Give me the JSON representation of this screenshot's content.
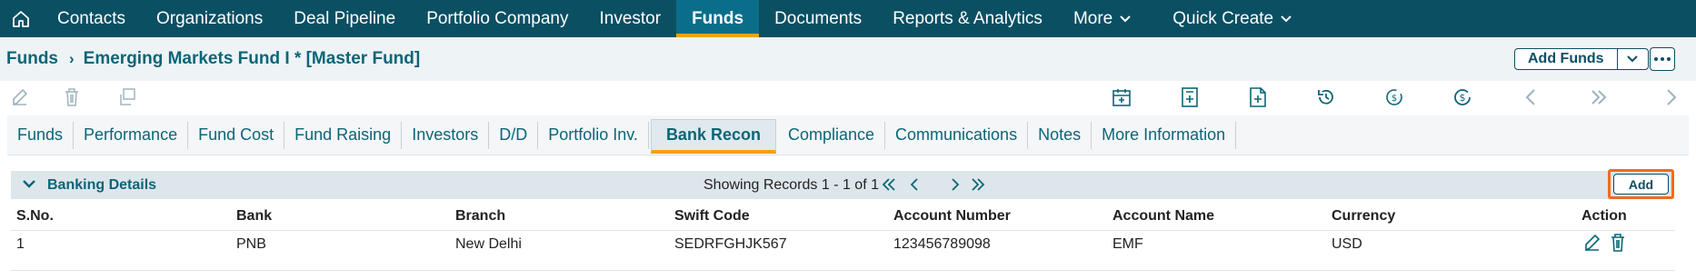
{
  "nav": {
    "items": [
      {
        "label": "Contacts"
      },
      {
        "label": "Organizations"
      },
      {
        "label": "Deal Pipeline"
      },
      {
        "label": "Portfolio Company"
      },
      {
        "label": "Investor"
      },
      {
        "label": "Funds",
        "active": true
      },
      {
        "label": "Documents"
      },
      {
        "label": "Reports & Analytics"
      },
      {
        "label": "More"
      },
      {
        "label": "Quick Create"
      }
    ]
  },
  "breadcrumb": {
    "root": "Funds",
    "title": "Emerging Markets Fund I * [Master Fund]"
  },
  "header": {
    "add_funds_label": "Add Funds"
  },
  "tabs": [
    {
      "label": "Funds"
    },
    {
      "label": "Performance"
    },
    {
      "label": "Fund Cost"
    },
    {
      "label": "Fund Raising"
    },
    {
      "label": "Investors"
    },
    {
      "label": "D/D"
    },
    {
      "label": "Portfolio Inv."
    },
    {
      "label": "Bank Recon",
      "active": true
    },
    {
      "label": "Compliance"
    },
    {
      "label": "Communications"
    },
    {
      "label": "Notes"
    },
    {
      "label": "More Information"
    }
  ],
  "panel": {
    "title": "Banking Details",
    "records_text": "Showing Records 1 - 1 of 1",
    "add_label": "Add"
  },
  "table": {
    "columns": [
      "S.No.",
      "Bank",
      "Branch",
      "Swift Code",
      "Account Number",
      "Account Name",
      "Currency",
      "Action"
    ],
    "rows": [
      [
        "1",
        "PNB",
        "New Delhi",
        "SEDRFGHJK567",
        "123456789098",
        "EMF",
        "USD"
      ]
    ]
  },
  "colors": {
    "nav_bg": "#0b4f63",
    "accent": "#f0a30a",
    "highlight": "#f26b1d",
    "primary_text": "#0b6577"
  }
}
